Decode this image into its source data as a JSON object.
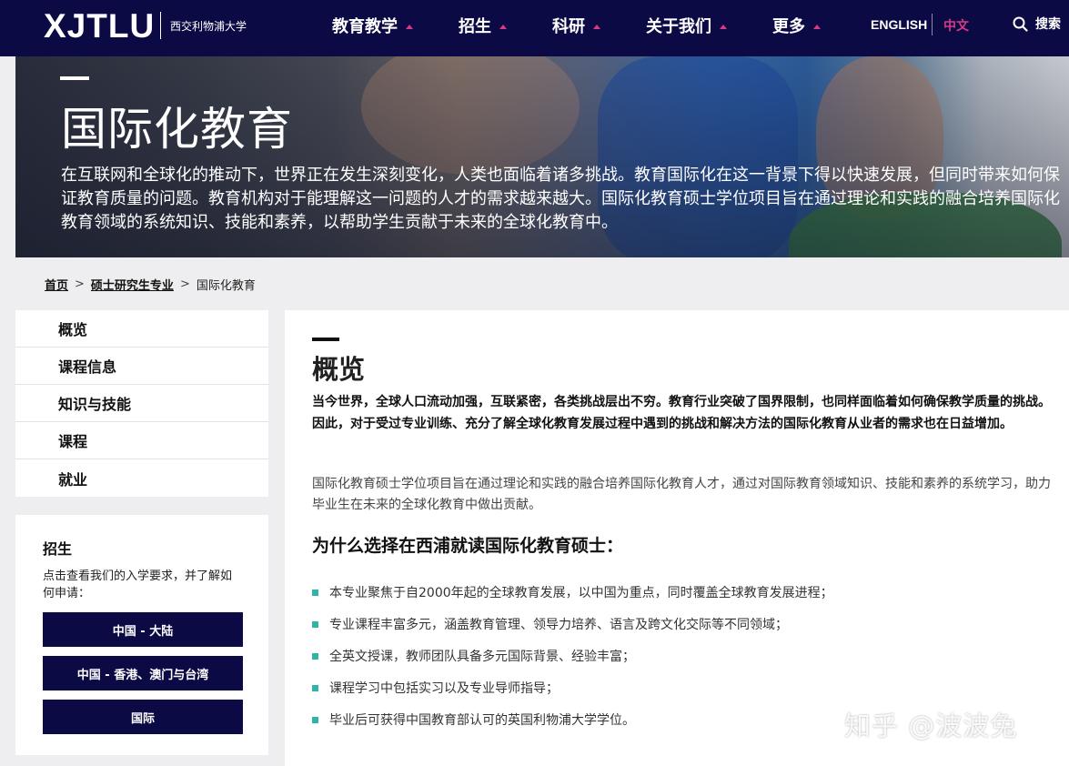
{
  "header": {
    "logo": "XJTLU",
    "logo_cn": "西交利物浦大学",
    "nav": [
      {
        "label": "教育教学"
      },
      {
        "label": "招生"
      },
      {
        "label": "科研"
      },
      {
        "label": "关于我们"
      },
      {
        "label": "更多"
      }
    ],
    "lang_en": "ENGLISH",
    "lang_cn": "中文",
    "search_label": "搜索",
    "accent_color": "#d63a86",
    "bg_color": "#0c0a44"
  },
  "hero": {
    "title": "国际化教育",
    "text": "在互联网和全球化的推动下，世界正在发生深刻变化，人类也面临着诸多挑战。教育国际化在这一背景下得以快速发展，但同时带来如何保证教育质量的问题。教育机构对于能理解这一问题的人才的需求越来越大。国际化教育硕士学位项目旨在通过理论和实践的融合培养国际化教育领域的系统知识、技能和素养，以帮助学生贡献于未来的全球化教育中。"
  },
  "breadcrumb": {
    "home": "首页",
    "sep1": ">",
    "parent": "硕士研究生专业",
    "sep2": ">",
    "current": "国际化教育"
  },
  "sidebar": {
    "items": [
      {
        "label": "概览"
      },
      {
        "label": "课程信息"
      },
      {
        "label": "知识与技能"
      },
      {
        "label": "课程"
      },
      {
        "label": "就业"
      }
    ]
  },
  "admission": {
    "title": "招生",
    "desc": "点击查看我们的入学要求，并了解如何申请：",
    "buttons": [
      {
        "label": "中国 - 大陆"
      },
      {
        "label": "中国 - 香港、澳门与台湾"
      },
      {
        "label": "国际"
      }
    ]
  },
  "main": {
    "title": "概览",
    "intro_bold": "当今世界，全球人口流动加强，互联紧密，各类挑战层出不穷。教育行业突破了国界限制，也同样面临着如何确保教学质量的挑战。因此，对于受过专业训练、充分了解全球化教育发展过程中遇到的挑战和解决方法的国际化教育从业者的需求也在日益增加。",
    "intro": "国际化教育硕士学位项目旨在通过理论和实践的融合培养国际化教育人才，通过对国际教育领域知识、技能和素养的系统学习，助力毕业生在未来的全球化教育中做出贡献。",
    "why_title": "为什么选择在西浦就读国际化教育硕士：",
    "bullets": [
      "本专业聚焦于自2000年起的全球教育发展，以中国为重点，同时覆盖全球教育发展进程；",
      "专业课程丰富多元，涵盖教育管理、领导力培养、语言及跨文化交际等不同领域；",
      "全英文授课，教师团队具备多元国际背景、经验丰富；",
      "课程学习中包括实习以及专业导师指导；",
      "毕业后可获得中国教育部认可的英国利物浦大学学位。"
    ],
    "bullet_color": "#2fb5a6"
  },
  "watermark": "知乎 @波波兔"
}
